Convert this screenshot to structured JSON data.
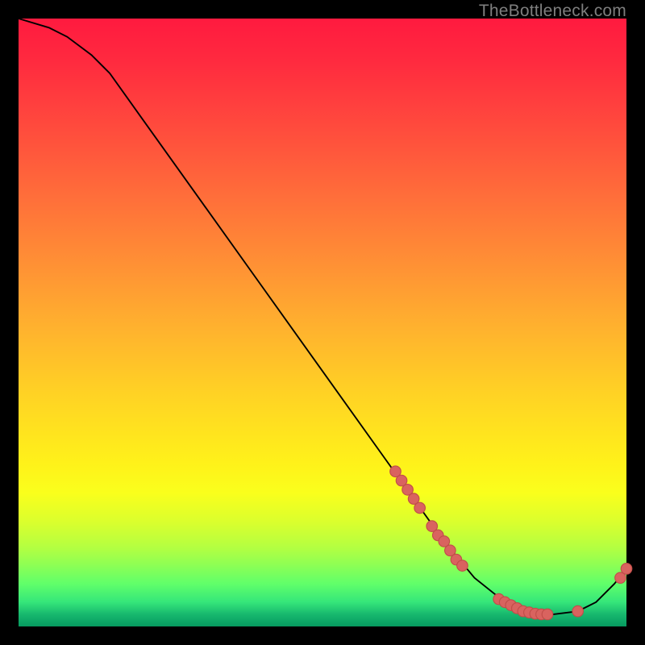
{
  "watermark": "TheBottleneck.com",
  "colors": {
    "line": "#000000",
    "marker_fill": "#d9635f",
    "marker_stroke": "#c14d49"
  },
  "chart_data": {
    "type": "line",
    "title": "",
    "xlabel": "",
    "ylabel": "",
    "xlim": [
      0,
      100
    ],
    "ylim": [
      0,
      100
    ],
    "grid": false,
    "legend": false,
    "curve": [
      {
        "x": 0,
        "y": 100
      },
      {
        "x": 5,
        "y": 98.5
      },
      {
        "x": 8,
        "y": 97
      },
      {
        "x": 12,
        "y": 94
      },
      {
        "x": 15,
        "y": 91
      },
      {
        "x": 20,
        "y": 84
      },
      {
        "x": 30,
        "y": 70
      },
      {
        "x": 40,
        "y": 56
      },
      {
        "x": 50,
        "y": 42
      },
      {
        "x": 60,
        "y": 28
      },
      {
        "x": 65,
        "y": 21
      },
      {
        "x": 70,
        "y": 14
      },
      {
        "x": 75,
        "y": 8
      },
      {
        "x": 80,
        "y": 4
      },
      {
        "x": 84,
        "y": 2
      },
      {
        "x": 88,
        "y": 2
      },
      {
        "x": 92,
        "y": 2.5
      },
      {
        "x": 95,
        "y": 4
      },
      {
        "x": 98,
        "y": 7
      },
      {
        "x": 100,
        "y": 9.5
      }
    ],
    "markers": [
      {
        "x": 62,
        "y": 25.5
      },
      {
        "x": 63,
        "y": 24
      },
      {
        "x": 64,
        "y": 22.5
      },
      {
        "x": 65,
        "y": 21
      },
      {
        "x": 66,
        "y": 19.5
      },
      {
        "x": 68,
        "y": 16.5
      },
      {
        "x": 69,
        "y": 15
      },
      {
        "x": 70,
        "y": 14
      },
      {
        "x": 71,
        "y": 12.5
      },
      {
        "x": 72,
        "y": 11
      },
      {
        "x": 73,
        "y": 10
      },
      {
        "x": 79,
        "y": 4.5
      },
      {
        "x": 80,
        "y": 4
      },
      {
        "x": 81,
        "y": 3.5
      },
      {
        "x": 82,
        "y": 3
      },
      {
        "x": 83,
        "y": 2.5
      },
      {
        "x": 84,
        "y": 2.3
      },
      {
        "x": 85,
        "y": 2.1
      },
      {
        "x": 86,
        "y": 2
      },
      {
        "x": 87,
        "y": 2
      },
      {
        "x": 92,
        "y": 2.5
      },
      {
        "x": 99,
        "y": 8
      },
      {
        "x": 100,
        "y": 9.5
      }
    ]
  }
}
